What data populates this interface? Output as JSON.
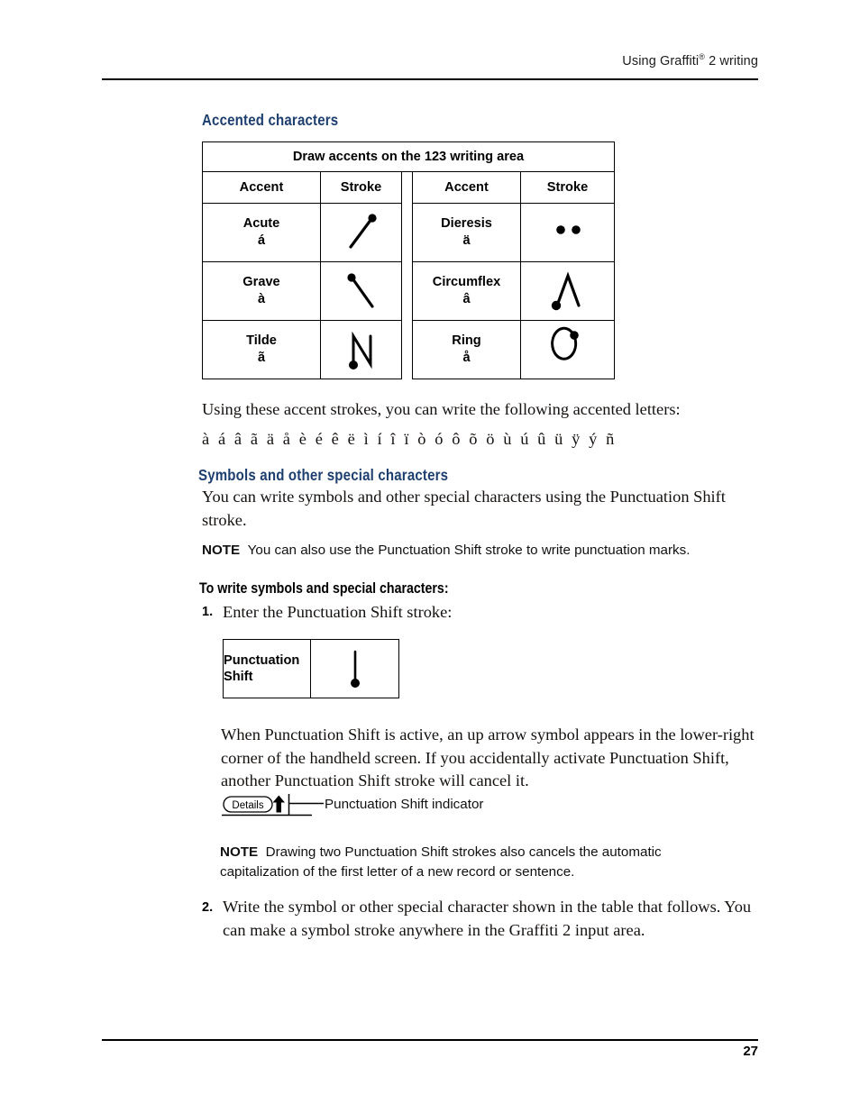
{
  "header": {
    "title_before": "Using Graffiti",
    "title_sup": "®",
    "title_after": " 2 writing"
  },
  "footer": {
    "page_number": "27"
  },
  "sections": {
    "accented_heading": "Accented characters",
    "symbols_heading": "Symbols and other special characters",
    "procedure_heading": "To write symbols and special characters:"
  },
  "accent_table": {
    "title": "Draw accents on the 123 writing area",
    "columns": [
      "Accent",
      "Stroke",
      "Accent",
      "Stroke"
    ],
    "rows": [
      {
        "left_name": "Acute",
        "left_char": "á",
        "left_stroke": "acute-stroke",
        "right_name": "Dieresis",
        "right_char": "ä",
        "right_stroke": "dieresis-stroke"
      },
      {
        "left_name": "Grave",
        "left_char": "à",
        "left_stroke": "grave-stroke",
        "right_name": "Circumflex",
        "right_char": "â",
        "right_stroke": "circumflex-stroke"
      },
      {
        "left_name": "Tilde",
        "left_char": "ã",
        "left_stroke": "tilde-stroke",
        "right_name": "Ring",
        "right_char": "å",
        "right_stroke": "ring-stroke"
      }
    ]
  },
  "body": {
    "intro_letters": "Using these accent strokes, you can write the following accented letters:",
    "accented_letters": "à á â ã ä å è é ê ë ì í î ï ò ó ô õ ö ù ú û ü ÿ ý ñ",
    "symbols_paragraph": "You can write symbols and other special characters using the Punctuation Shift stroke.",
    "note1_label": "NOTE",
    "note1_text": "You can also use the Punctuation Shift stroke to write punctuation marks.",
    "step1_num": "1.",
    "step1_text": "Enter the Punctuation Shift stroke:",
    "paragraph_after_table": "When Punctuation Shift is active, an up arrow symbol appears in the lower-right corner of the handheld screen. If you accidentally activate Punctuation Shift, another Punctuation Shift stroke will cancel it.",
    "note2_label": "NOTE",
    "note2_text": "Drawing two Punctuation Shift strokes also cancels the automatic capitalization of the first letter of a new record or sentence.",
    "step2_num": "2.",
    "step2_text": "Write the symbol or other special character shown in the table that follows. You can make a symbol stroke anywhere in the Graffiti 2 input area."
  },
  "punctuation_table": {
    "label_line1": "Punctuation",
    "label_line2": "Shift",
    "stroke": "punctuation-shift-stroke"
  },
  "indicator_figure": {
    "button_label": "Details",
    "arrow_icon": "up-arrow-icon",
    "caption": "Punctuation Shift indicator"
  },
  "colors": {
    "heading_blue": "#1d3f70",
    "text_black": "#15110f",
    "rule": "#000000"
  }
}
